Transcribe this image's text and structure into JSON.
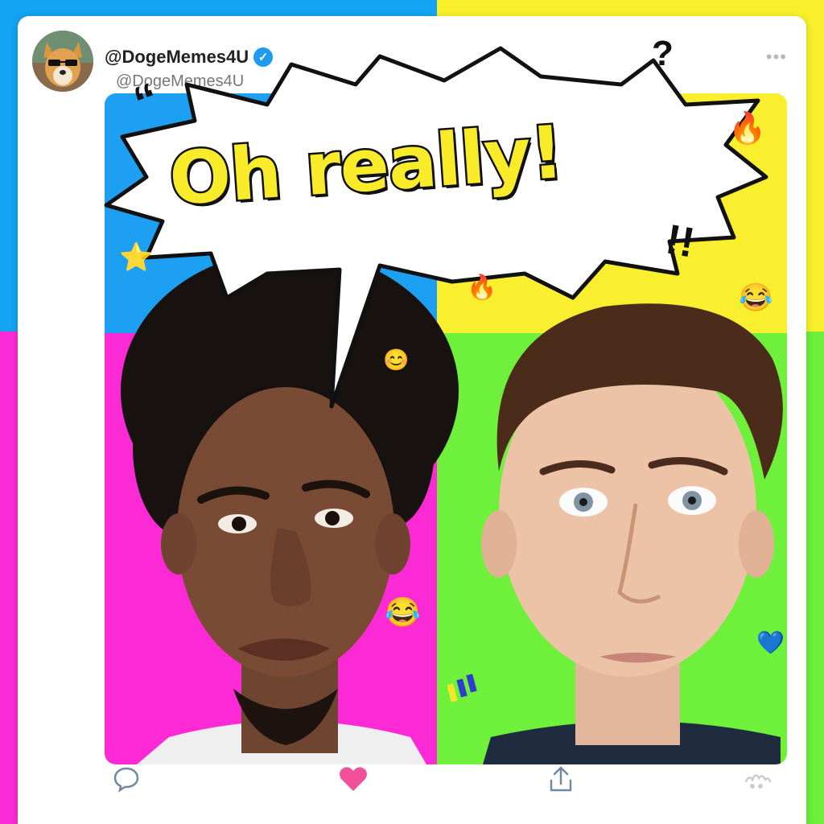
{
  "post": {
    "display_name": "@DogeMemes4U",
    "handle": "@DogeMemes4U",
    "verified": true,
    "more_icon": "more-horizontal-icon"
  },
  "meme": {
    "speech_text": "Oh really!",
    "question_mark": "?",
    "exclamations": "!!",
    "quote_marks": "“",
    "emojis": [
      "🔥",
      "⭐",
      "🔥",
      "😂",
      "😊",
      "😂",
      "💙"
    ]
  },
  "actions": {
    "reply_icon": "comment-icon",
    "like_icon": "heart-icon",
    "share_icon": "share-icon",
    "analytics_icon": "analytics-icon"
  },
  "colors": {
    "blue": "#1ea0f2",
    "yellow": "#f9ef2e",
    "magenta": "#fb2ad4",
    "green": "#6ff03b",
    "verified": "#1d9bf0",
    "like": "#f1509a"
  }
}
